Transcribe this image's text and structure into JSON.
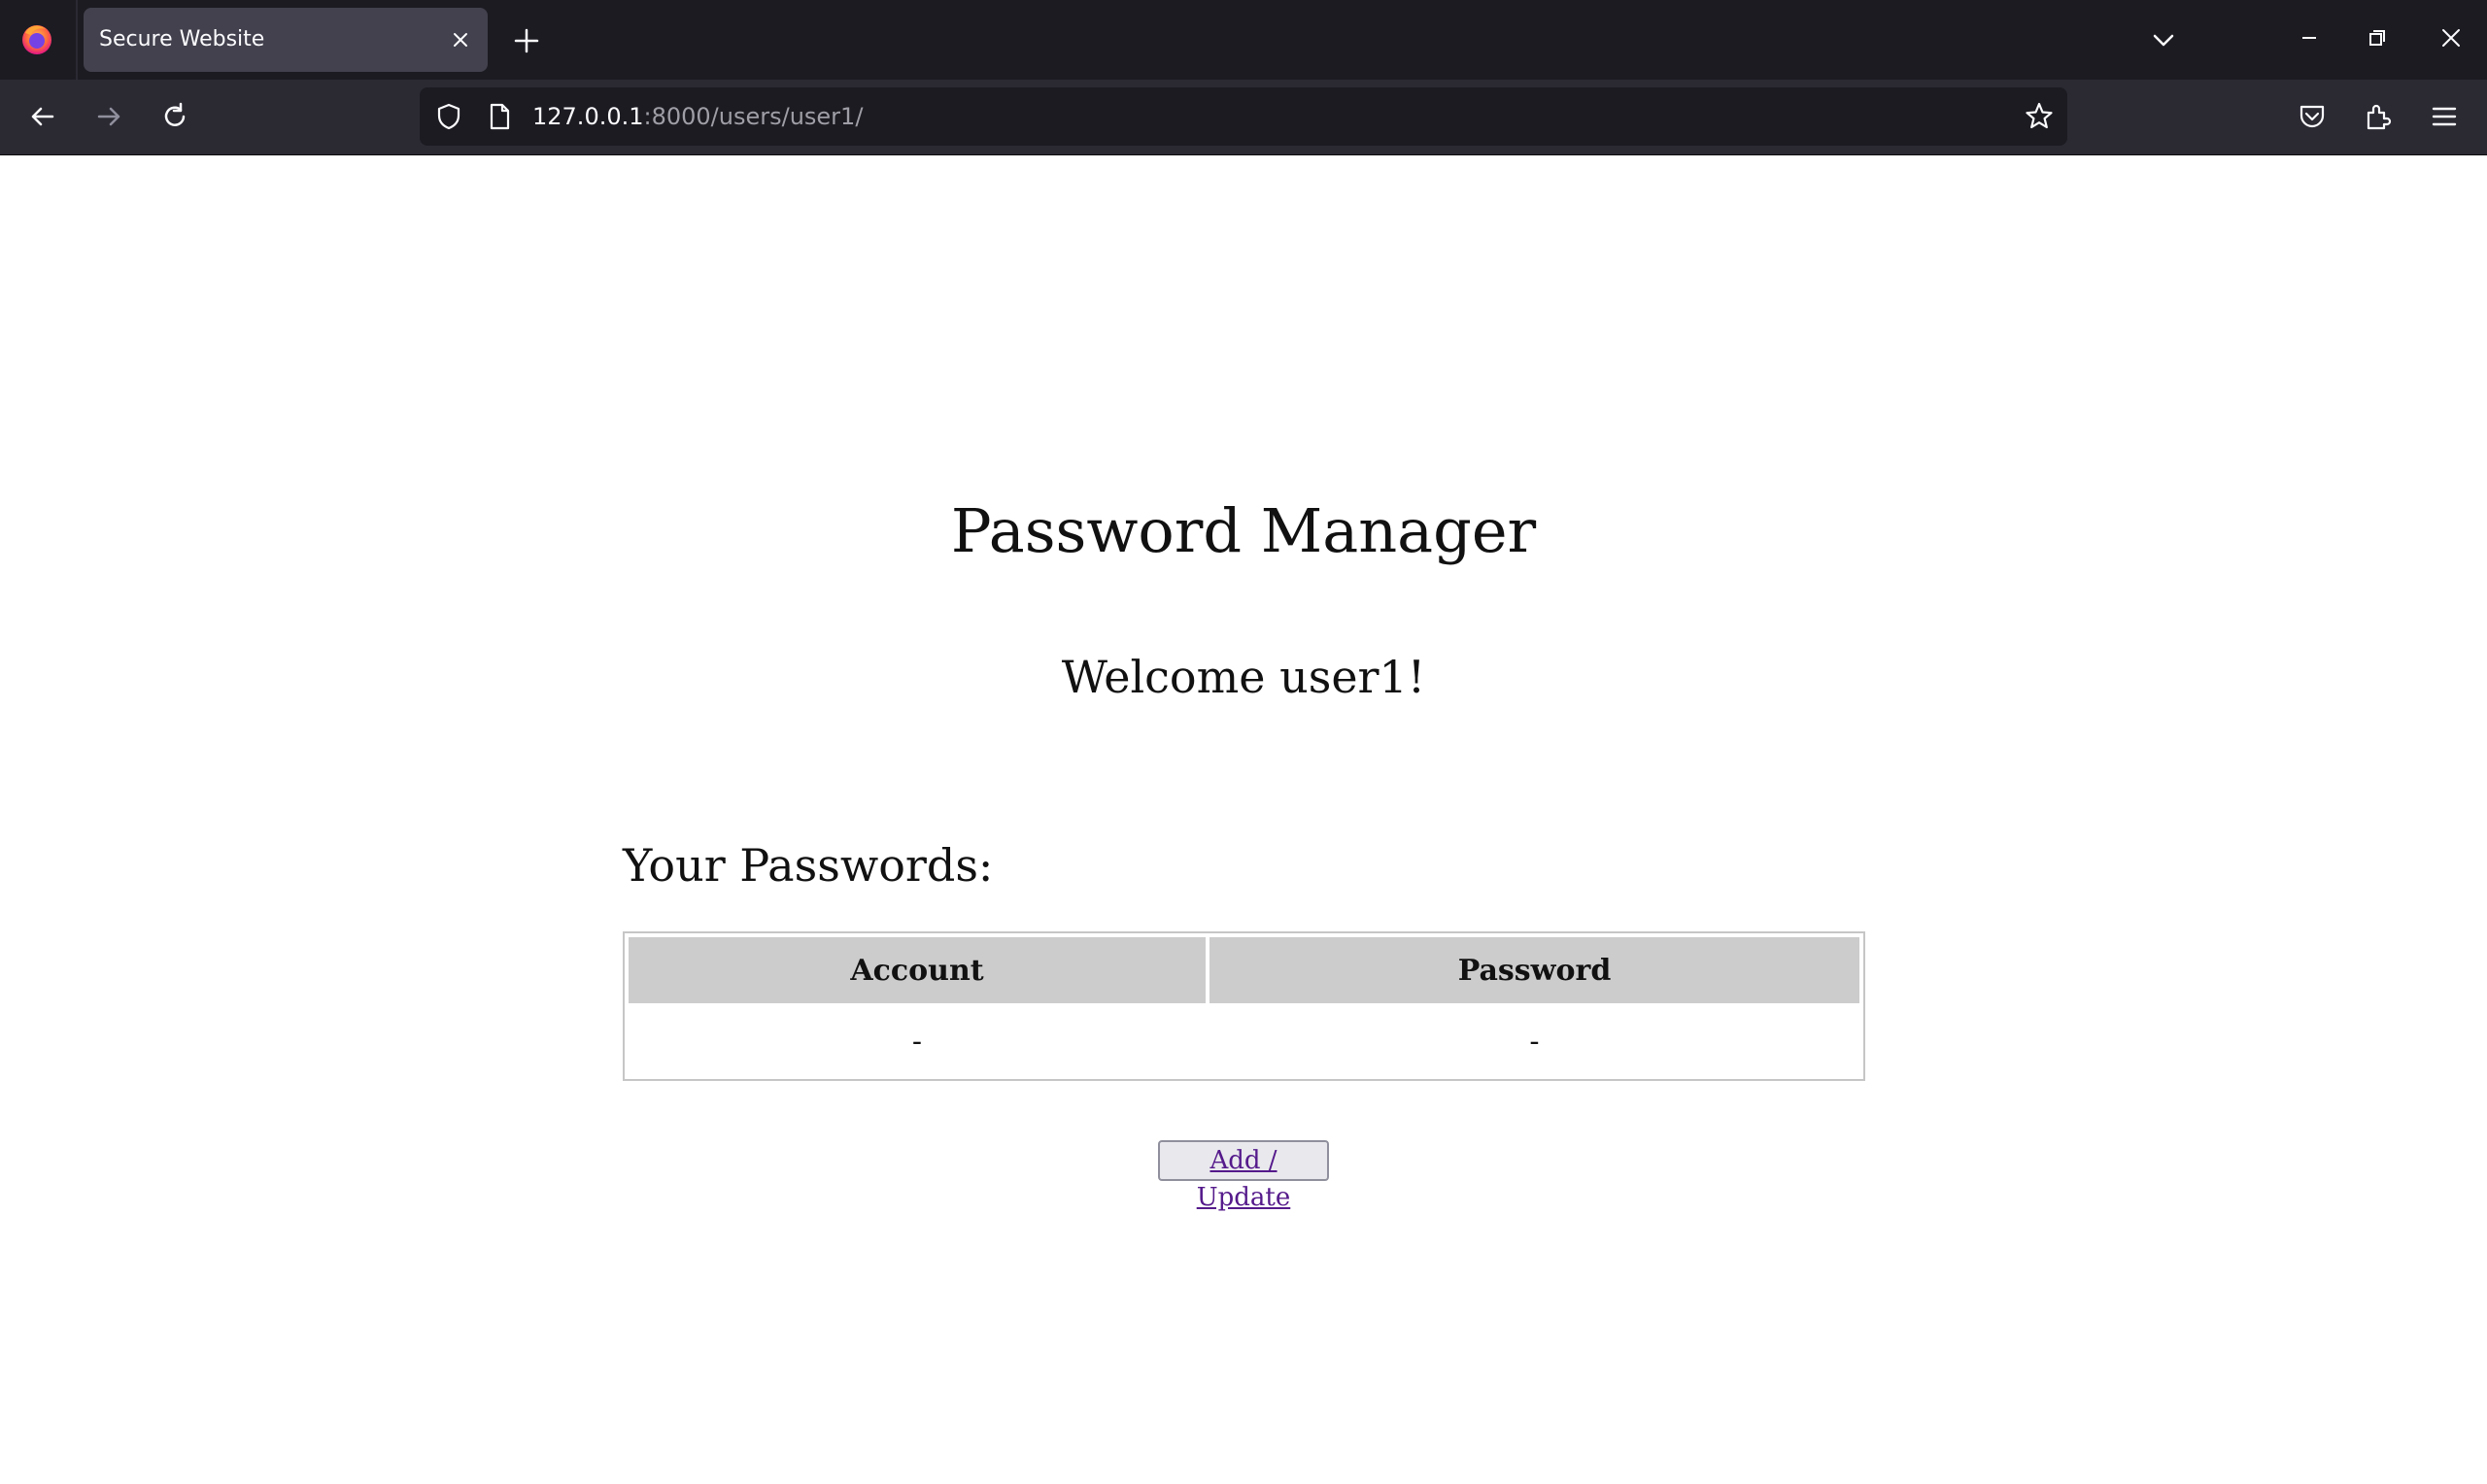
{
  "browser": {
    "tab_title": "Secure Website",
    "url_host": "127.0.0.1",
    "url_path": ":8000/users/user1/",
    "colors": {
      "tabbar_bg": "#1c1b22",
      "toolbar_bg": "#2b2a33",
      "active_tab_bg": "#42414d"
    }
  },
  "page": {
    "title": "Password Manager",
    "welcome": "Welcome user1!",
    "section_heading": "Your Passwords:",
    "table": {
      "headers": [
        "Account",
        "Password"
      ],
      "rows": [
        [
          "-",
          "-"
        ]
      ]
    },
    "add_button_label": "Add / Update",
    "colors": {
      "header_cell_bg": "#cccccc",
      "link_color": "#551a8b"
    }
  }
}
